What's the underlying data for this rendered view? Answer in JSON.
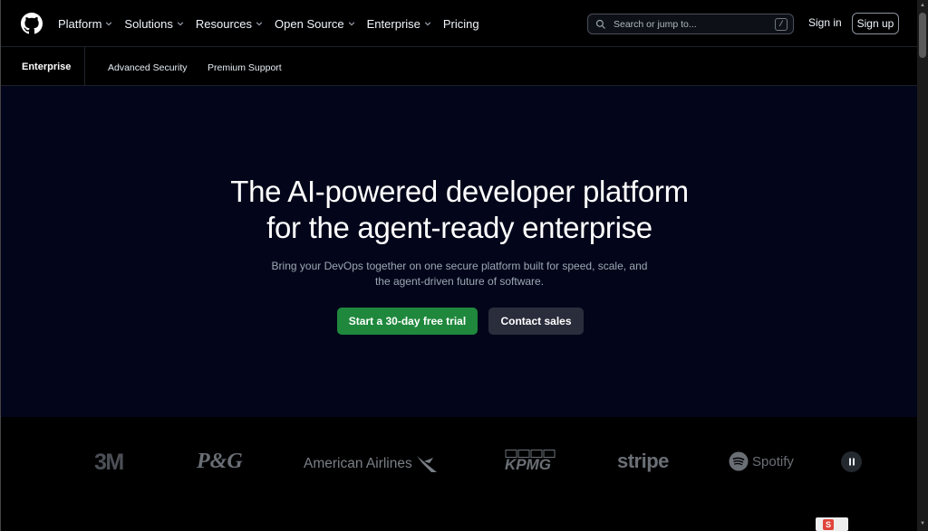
{
  "header": {
    "nav": [
      {
        "label": "Platform",
        "has_menu": true
      },
      {
        "label": "Solutions",
        "has_menu": true
      },
      {
        "label": "Resources",
        "has_menu": true
      },
      {
        "label": "Open Source",
        "has_menu": true
      },
      {
        "label": "Enterprise",
        "has_menu": true
      },
      {
        "label": "Pricing",
        "has_menu": false
      }
    ],
    "search_placeholder": "Search or jump to...",
    "search_shortcut": "/",
    "signin_label": "Sign in",
    "signup_label": "Sign up"
  },
  "subnav": {
    "title": "Enterprise",
    "links": [
      "Advanced Security",
      "Premium Support"
    ]
  },
  "hero": {
    "title_line1": "The AI-powered developer platform",
    "title_line2": "for the agent-ready enterprise",
    "subtitle_line1": "Bring your DevOps together on one secure platform built for speed, scale, and",
    "subtitle_line2": "the agent-driven future of software.",
    "primary_cta": "Start a 30-day free trial",
    "secondary_cta": "Contact sales"
  },
  "logos": [
    "3M",
    "P&G",
    "American Airlines",
    "KPMG",
    "stripe",
    "Spotify"
  ],
  "colors": {
    "hero_bg": "#03061a",
    "primary_button": "#1f883d",
    "secondary_button": "#2a2d3b",
    "page_bg": "#000000"
  }
}
